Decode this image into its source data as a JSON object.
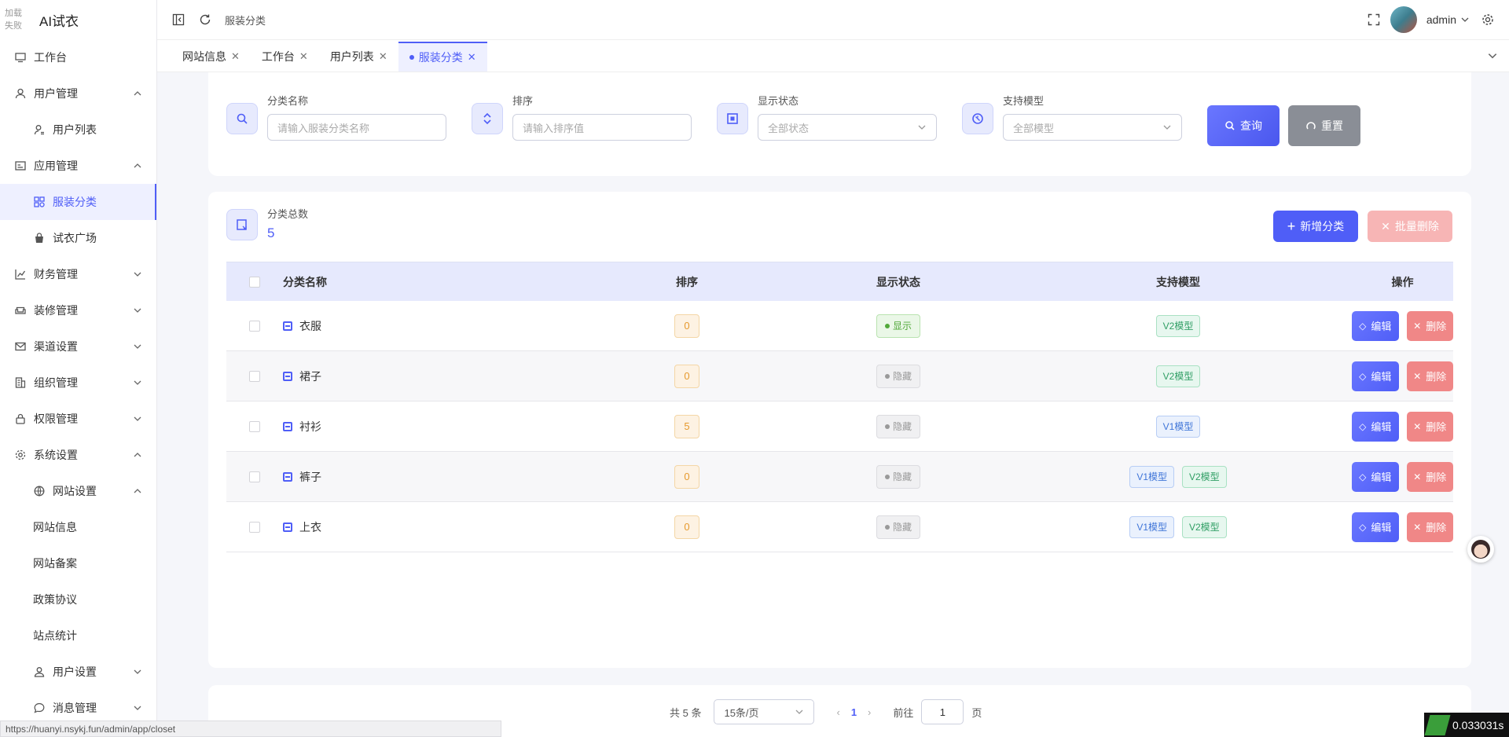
{
  "app": {
    "logo_alt": "加载失败",
    "logo_alt_line1": "加载",
    "logo_alt_line2": "失败",
    "title": "AI试衣"
  },
  "sidebar": {
    "items": [
      {
        "label": "工作台",
        "icon": "monitor-icon"
      },
      {
        "label": "用户管理",
        "icon": "user-icon",
        "expanded": true
      },
      {
        "label": "用户列表",
        "icon": "user-list-icon"
      },
      {
        "label": "应用管理",
        "icon": "app-icon",
        "expanded": true
      },
      {
        "label": "服装分类",
        "icon": "category-icon",
        "active": true
      },
      {
        "label": "试衣广场",
        "icon": "bag-icon"
      },
      {
        "label": "财务管理",
        "icon": "chart-icon"
      },
      {
        "label": "装修管理",
        "icon": "sofa-icon"
      },
      {
        "label": "渠道设置",
        "icon": "mail-icon"
      },
      {
        "label": "组织管理",
        "icon": "building-icon"
      },
      {
        "label": "权限管理",
        "icon": "lock-icon"
      },
      {
        "label": "系统设置",
        "icon": "gear-icon",
        "expanded": true
      },
      {
        "label": "网站设置",
        "icon": "globe-icon",
        "expanded": true
      },
      {
        "label": "网站信息"
      },
      {
        "label": "网站备案"
      },
      {
        "label": "政策协议"
      },
      {
        "label": "站点统计"
      },
      {
        "label": "用户设置",
        "icon": "user-settings-icon"
      },
      {
        "label": "消息管理",
        "icon": "message-icon"
      }
    ]
  },
  "header": {
    "breadcrumb": "服装分类",
    "username": "admin"
  },
  "tabs": [
    {
      "label": "网站信息"
    },
    {
      "label": "工作台"
    },
    {
      "label": "用户列表"
    },
    {
      "label": "服装分类",
      "active": true
    }
  ],
  "filters": {
    "name": {
      "label": "分类名称",
      "placeholder": "请输入服装分类名称"
    },
    "sort": {
      "label": "排序",
      "placeholder": "请输入排序值"
    },
    "status": {
      "label": "显示状态",
      "value": "全部状态"
    },
    "model": {
      "label": "支持模型",
      "value": "全部模型"
    },
    "query_label": "查询",
    "reset_label": "重置"
  },
  "summary": {
    "label": "分类总数",
    "value": "5",
    "add_label": "新增分类",
    "batch_delete_label": "批量删除"
  },
  "table": {
    "headers": {
      "name": "分类名称",
      "sort": "排序",
      "status": "显示状态",
      "model": "支持模型",
      "ops": "操作"
    },
    "edit_label": "编辑",
    "delete_label": "删除",
    "rows": [
      {
        "name": "衣服",
        "sort": "0",
        "status": "显示",
        "models": [
          "V2模型"
        ]
      },
      {
        "name": "裙子",
        "sort": "0",
        "status": "隐藏",
        "models": [
          "V2模型"
        ]
      },
      {
        "name": "衬衫",
        "sort": "5",
        "status": "隐藏",
        "models": [
          "V1模型"
        ]
      },
      {
        "name": "裤子",
        "sort": "0",
        "status": "隐藏",
        "models": [
          "V1模型",
          "V2模型"
        ]
      },
      {
        "name": "上衣",
        "sort": "0",
        "status": "隐藏",
        "models": [
          "V1模型",
          "V2模型"
        ]
      }
    ]
  },
  "pagination": {
    "total": "共 5 条",
    "page_size": "15条/页",
    "current": "1",
    "goto_label": "前往",
    "goto_value": "1",
    "page_suffix": "页"
  },
  "browser": {
    "status_url": "https://huanyi.nsykj.fun/admin/app/closet",
    "timer": "0.033031s"
  },
  "colors": {
    "accent": "#4f5ef7",
    "danger": "#f08787",
    "success": "#51a83a"
  }
}
